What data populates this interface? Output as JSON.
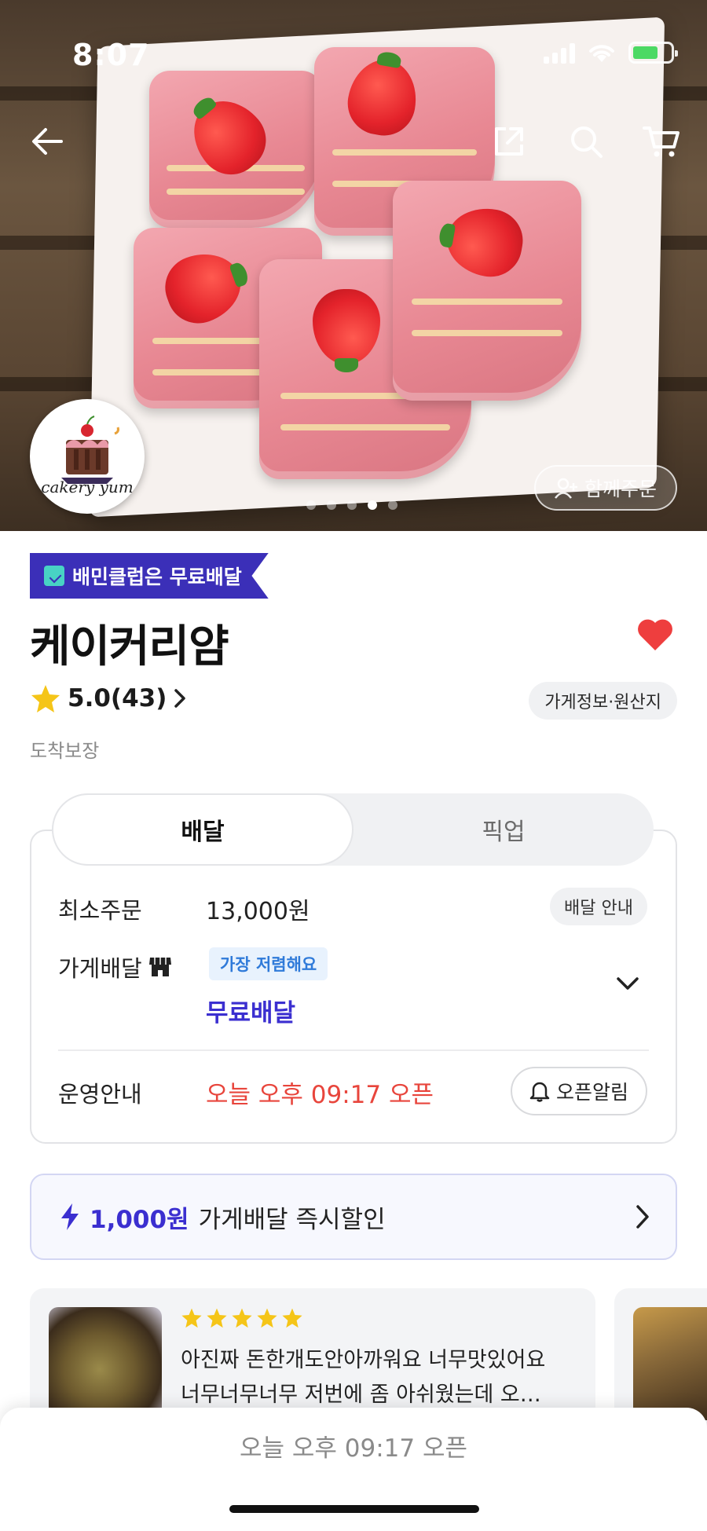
{
  "status_bar": {
    "time": "8:07"
  },
  "hero": {
    "logo_text": "cakery yum",
    "together_order_label": "함께주문",
    "carousel": {
      "count": 5,
      "active_index": 3
    }
  },
  "store": {
    "club_badge": "배민클럽은 무료배달",
    "name": "케이커리얌",
    "rating": "5.0(43)",
    "info_chip": "가게정보·원산지",
    "arrival_guarantee": "도착보장",
    "favorited": true
  },
  "tabs": {
    "delivery": "배달",
    "pickup": "픽업"
  },
  "delivery_card": {
    "min_order_label": "최소주문",
    "min_order_value": "13,000원",
    "delivery_info_button": "배달 안내",
    "store_delivery_label": "가게배달",
    "cheapest_badge": "가장 저렴해요",
    "free_delivery": "무료배달",
    "operation_label": "운영안내",
    "operation_value": "오늘 오후 09:17 오픈",
    "open_alarm_button": "오픈알림"
  },
  "discount_banner": {
    "amount": "1,000원",
    "text": "가게배달 즉시할인"
  },
  "reviews": [
    {
      "stars": 5,
      "line1": "아진짜 돈한개도안아까워요 너무맛있어요",
      "line2": "너무너무너무 저번에 좀 아쉬웠는데 오…"
    }
  ],
  "bottom_bar": {
    "text": "오늘 오후 09:17 오픈"
  },
  "colors": {
    "accent_purple": "#3b2fd0",
    "club_badge_bg": "#3b2fb8",
    "alert_red": "#e8453c",
    "star_yellow": "#f5c518",
    "heart_red": "#ee3e3e"
  }
}
